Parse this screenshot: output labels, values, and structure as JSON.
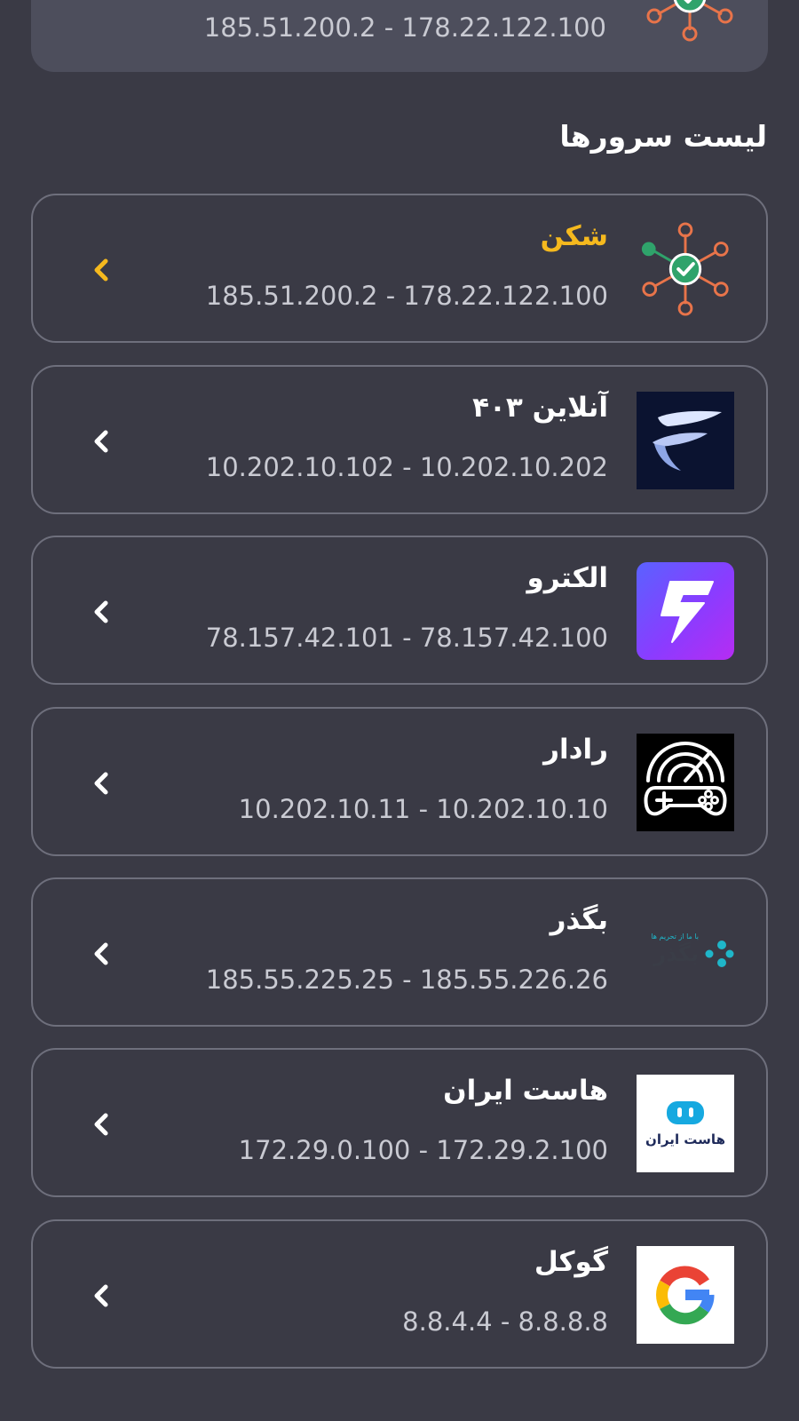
{
  "top_card": {
    "ips": "185.51.200.2 - 178.22.122.100",
    "icon": "network-check-icon"
  },
  "section_title": "لیست سرورها",
  "servers": [
    {
      "name": "شکن",
      "ips": "185.51.200.2 - 178.22.122.100",
      "icon": "network-check-icon",
      "active": true
    },
    {
      "name": "آنلاین ۴۰۳",
      "ips": "10.202.10.102 - 10.202.10.202",
      "icon": "403-online-logo",
      "active": false
    },
    {
      "name": "الکترو",
      "ips": "78.157.42.101 - 78.157.42.100",
      "icon": "electro-logo",
      "active": false
    },
    {
      "name": "رادار",
      "ips": "10.202.10.11 - 10.202.10.10",
      "icon": "radar-gamepad-logo",
      "active": false
    },
    {
      "name": "بگذر",
      "ips": "185.55.225.25 - 185.55.226.26",
      "icon": "begzar-logo",
      "active": false
    },
    {
      "name": "هاست ایران",
      "ips": "172.29.0.100 - 172.29.2.100",
      "icon": "host-iran-logo",
      "active": false
    },
    {
      "name": "گوکل",
      "ips": "8.8.4.4 - 8.8.8.8",
      "icon": "google-logo",
      "active": false
    }
  ],
  "colors": {
    "background": "#3a3a45",
    "accent": "#f5b91e",
    "card_border": "#6e6f7c",
    "check_green": "#2fa36b",
    "node_orange": "#e8744a"
  },
  "logo_text": {
    "begzar_tag": "با ما از تحریم ها",
    "begzar_word": "بگذر",
    "host_iran_word": "هاست ایران"
  }
}
